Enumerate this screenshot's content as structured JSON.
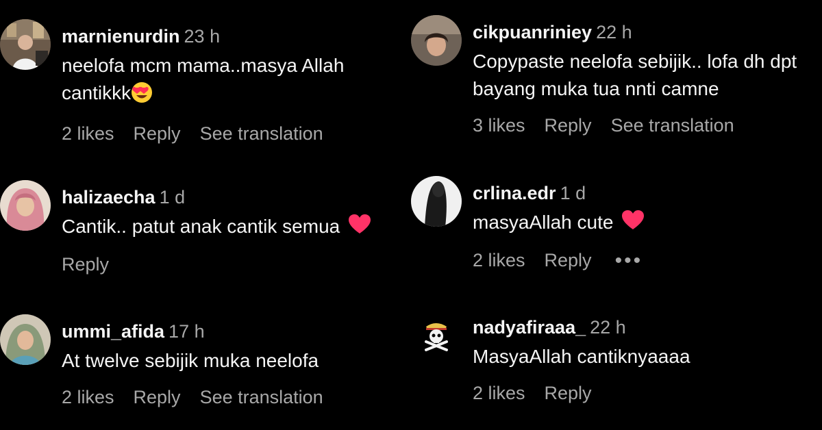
{
  "colors": {
    "background": "#000000",
    "text": "#f5f5f5",
    "muted": "#a8a8a8",
    "heart": "#ff3367"
  },
  "left_column": [
    {
      "username": "marnienurdin",
      "time": "23 h",
      "text": "neelofa mcm mama..masya Allah cantikkk",
      "emoji": "heart-eyes-emoji",
      "likes": "2 likes",
      "reply": "Reply",
      "translate": "See translation"
    },
    {
      "username": "halizaecha",
      "time": "1 d",
      "text": "Cantik.. patut anak cantik semua",
      "emoji": "heart-icon",
      "reply": "Reply"
    },
    {
      "username": "ummi_afida",
      "time": "17 h",
      "text": "At twelve sebijik muka neelofa",
      "likes": "2 likes",
      "reply": "Reply",
      "translate": "See translation"
    }
  ],
  "right_column": [
    {
      "username": "cikpuanriniey",
      "time": "22 h",
      "text": "Copypaste neelofa sebijik.. lofa dh dpt bayang muka tua nnti camne",
      "likes": "3 likes",
      "reply": "Reply",
      "translate": "See translation"
    },
    {
      "username": "crlina.edr",
      "time": "1 d",
      "text": "masyaAllah cute",
      "emoji": "heart-icon",
      "likes": "2 likes",
      "reply": "Reply",
      "more": "•••"
    },
    {
      "username": "nadyafiraaa_",
      "time": "22 h",
      "text": "MasyaAllah cantiknyaaaa",
      "likes": "2 likes",
      "reply": "Reply"
    }
  ]
}
